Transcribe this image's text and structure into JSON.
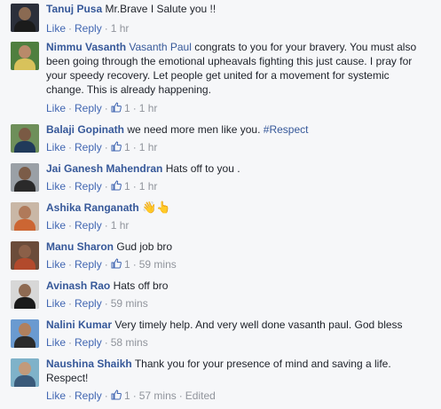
{
  "labels": {
    "like": "Like",
    "reply": "Reply",
    "dot": "·"
  },
  "colors": {
    "link": "#365899",
    "action": "#4267b2",
    "meta": "#90949c",
    "background": "#f6f7f9"
  },
  "comments": [
    {
      "author": "Tanuj Pusa",
      "text": "Mr.Brave I Salute you !!",
      "likes": "",
      "time": "1 hr",
      "avatar": {
        "bg": "#2b2f3a",
        "skin": "#8a6a52",
        "shirt": "#1b1b1b"
      }
    },
    {
      "author": "Nimmu Vasanth",
      "mention": "Vasanth Paul",
      "text": " congrats to you for your bravery. You must also been going through the emotional upheavals fighting this just cause. I pray for your speedy recovery. Let people get united for a movement for systemic change. This is already happening.",
      "likes": "1",
      "time": "1 hr",
      "avatar": {
        "bg": "#4f7f3f",
        "skin": "#b98a6a",
        "shirt": "#d8c25b"
      }
    },
    {
      "author": "Balaji Gopinath",
      "text": "we need more men like you. ",
      "hashtag": "#Respect",
      "likes": "1",
      "time": "1 hr",
      "avatar": {
        "bg": "#6e8f5a",
        "skin": "#7a5a44",
        "shirt": "#203a5a"
      }
    },
    {
      "author": "Jai Ganesh Mahendran",
      "text": "Hats off to you .",
      "likes": "1",
      "time": "1 hr",
      "avatar": {
        "bg": "#9aa0a6",
        "skin": "#7b5c48",
        "shirt": "#2a2a2a"
      }
    },
    {
      "author": "Ashika Ranganath",
      "text": "",
      "emoji": "👋👆",
      "likes": "",
      "time": "1 hr",
      "avatar": {
        "bg": "#c9b7a6",
        "skin": "#b07a5a",
        "shirt": "#cc6633"
      }
    },
    {
      "author": "Manu Sharon",
      "text": "Gud job bro",
      "likes": "1",
      "time": "59 mins",
      "avatar": {
        "bg": "#6b4c3a",
        "skin": "#8b6048",
        "shirt": "#b24a2c"
      }
    },
    {
      "author": "Avinash Rao",
      "text": "Hats off bro",
      "likes": "",
      "time": "59 mins",
      "avatar": {
        "bg": "#d7d7d7",
        "skin": "#8e6a52",
        "shirt": "#1a1a1a"
      }
    },
    {
      "author": "Nalini Kumar",
      "text": "Very timely help. And very well done vasanth paul. God bless",
      "likes": "",
      "time": "58 mins",
      "avatar": {
        "bg": "#6a9ad0",
        "skin": "#b0805e",
        "shirt": "#2b2b2b"
      }
    },
    {
      "author": "Naushina Shaikh",
      "text": "Thank you for your presence of mind and saving a life. Respect!",
      "likes": "1",
      "time": "57 mins",
      "edited": "Edited",
      "avatar": {
        "bg": "#7fb2c9",
        "skin": "#c29a7a",
        "shirt": "#3a5a7a"
      }
    }
  ]
}
